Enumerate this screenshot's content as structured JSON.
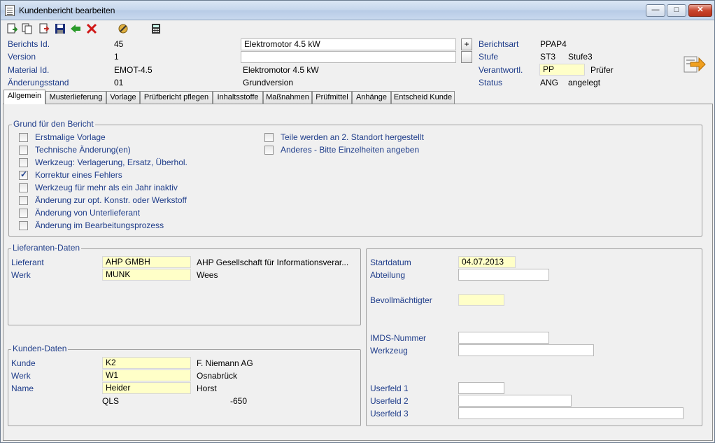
{
  "window": {
    "title": "Kundenbericht bearbeiten",
    "controls": {
      "minimize": "—",
      "maximize": "□",
      "close": "✕"
    }
  },
  "toolbar": {
    "icons": [
      "new-document-icon",
      "copy-icon",
      "export-icon",
      "save-icon",
      "back-arrow-icon",
      "delete-icon",
      "tools-icon",
      "calculator-icon"
    ]
  },
  "header": {
    "berichts_id": {
      "label": "Berichts Id.",
      "value": "45"
    },
    "version": {
      "label": "Version",
      "value": "1"
    },
    "material_id": {
      "label": "Material Id.",
      "value": "EMOT-4.5",
      "desc": "Elektromotor 4.5 kW"
    },
    "aenderungsstand": {
      "label": "Änderungsstand",
      "value": "01",
      "desc": "Grundversion"
    },
    "title_field": "Elektromotor 4.5 kW",
    "title_field2": "",
    "plus_button": "+",
    "berichtsart": {
      "label": "Berichtsart",
      "value": "PPAP4"
    },
    "stufe": {
      "label": "Stufe",
      "value": "ST3",
      "desc": "Stufe3"
    },
    "verantwortl": {
      "label": "Verantwortl.",
      "value": "PP",
      "desc": "Prüfer"
    },
    "status": {
      "label": "Status",
      "value": "ANG",
      "desc": "angelegt"
    }
  },
  "tabs": [
    "Allgemein",
    "Musterlieferung",
    "Vorlage",
    "Prüfbericht pflegen",
    "Inhaltsstoffe",
    "Maßnahmen",
    "Prüfmittel",
    "Anhänge",
    "Entscheid Kunde"
  ],
  "active_tab": "Allgemein",
  "grund": {
    "title": "Grund für den Bericht",
    "left": [
      {
        "label": "Erstmalige Vorlage",
        "checked": false
      },
      {
        "label": "Technische Änderung(en)",
        "checked": false
      },
      {
        "label": "Werkzeug: Verlagerung, Ersatz, Überhol.",
        "checked": false
      },
      {
        "label": "Korrektur eines Fehlers",
        "checked": true
      },
      {
        "label": "Werkzeug für mehr als ein Jahr inaktiv",
        "checked": false
      },
      {
        "label": "Änderung zur opt. Konstr. oder Werkstoff",
        "checked": false
      },
      {
        "label": "Änderung von Unterlieferant",
        "checked": false
      },
      {
        "label": "Änderung im Bearbeitungsprozess",
        "checked": false
      }
    ],
    "right": [
      {
        "label": "Teile werden an 2. Standort hergestellt",
        "checked": false
      },
      {
        "label": "Anderes - Bitte Einzelheiten angeben",
        "checked": false
      }
    ]
  },
  "lieferanten": {
    "title": "Lieferanten-Daten",
    "lieferant": {
      "label": "Lieferant",
      "value": "AHP GMBH",
      "desc": "AHP Gesellschaft für Informationsverar..."
    },
    "werk": {
      "label": "Werk",
      "value": "MUNK",
      "desc": "Wees"
    }
  },
  "kunden": {
    "title": "Kunden-Daten",
    "kunde": {
      "label": "Kunde",
      "value": "K2",
      "desc": "F. Niemann AG"
    },
    "werk": {
      "label": "Werk",
      "value": "W1",
      "desc": "Osnabrück"
    },
    "name": {
      "label": "Name",
      "value": "Heider",
      "desc": "Horst"
    },
    "extra_code": "QLS",
    "extra_value": "-650"
  },
  "right_panel": {
    "startdatum": {
      "label": "Startdatum",
      "value": "04.07.2013"
    },
    "abteilung": {
      "label": "Abteilung",
      "value": ""
    },
    "bevollmaechtigter": {
      "label": "Bevollmächtigter",
      "value": ""
    },
    "imds": {
      "label": "IMDS-Nummer",
      "value": ""
    },
    "werkzeug": {
      "label": "Werkzeug",
      "value": ""
    },
    "userfeld1": {
      "label": "Userfeld 1",
      "value": ""
    },
    "userfeld2": {
      "label": "Userfeld 2",
      "value": ""
    },
    "userfeld3": {
      "label": "Userfeld 3",
      "value": ""
    }
  }
}
